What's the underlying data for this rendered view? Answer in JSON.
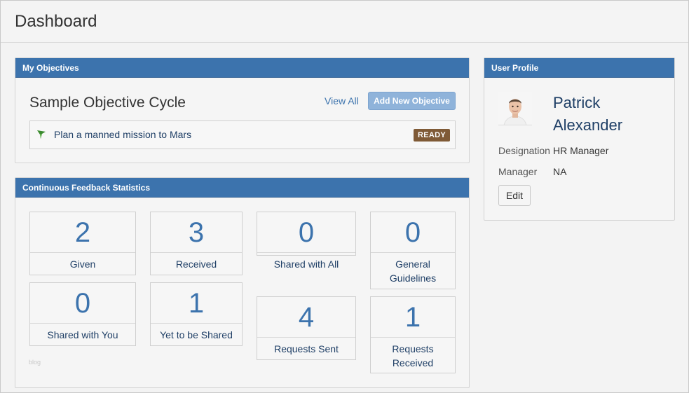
{
  "page": {
    "title": "Dashboard"
  },
  "objectives": {
    "panel_title": "My Objectives",
    "cycle_title": "Sample Objective Cycle",
    "view_all": "View All",
    "add_new": "Add New Objective",
    "items": [
      {
        "text": "Plan a manned mission to Mars",
        "status": "READY",
        "icon": "flag-icon",
        "icon_color": "#3a8a2e"
      }
    ]
  },
  "feedback": {
    "panel_title": "Continuous Feedback Statistics",
    "stats": [
      {
        "value": "2",
        "label": "Given"
      },
      {
        "value": "3",
        "label": "Received"
      },
      {
        "value": "0",
        "label": "Shared with All"
      },
      {
        "value": "0",
        "label": "General Guidelines"
      },
      {
        "value": "0",
        "label": "Shared with You"
      },
      {
        "value": "1",
        "label": "Yet to be Shared"
      },
      {
        "value": "4",
        "label": "Requests Sent"
      },
      {
        "value": "1",
        "label": "Requests Received"
      }
    ],
    "footer_text": "blog"
  },
  "profile": {
    "panel_title": "User Profile",
    "name": "Patrick Alexander",
    "designation_label": "Designation",
    "designation_value": "HR Manager",
    "manager_label": "Manager",
    "manager_value": "NA",
    "edit_label": "Edit"
  },
  "colors": {
    "panel_header": "#3c73ad",
    "accent_text": "#1f3f66",
    "ready_badge": "#7f5a36",
    "add_button": "#8fb3da"
  }
}
